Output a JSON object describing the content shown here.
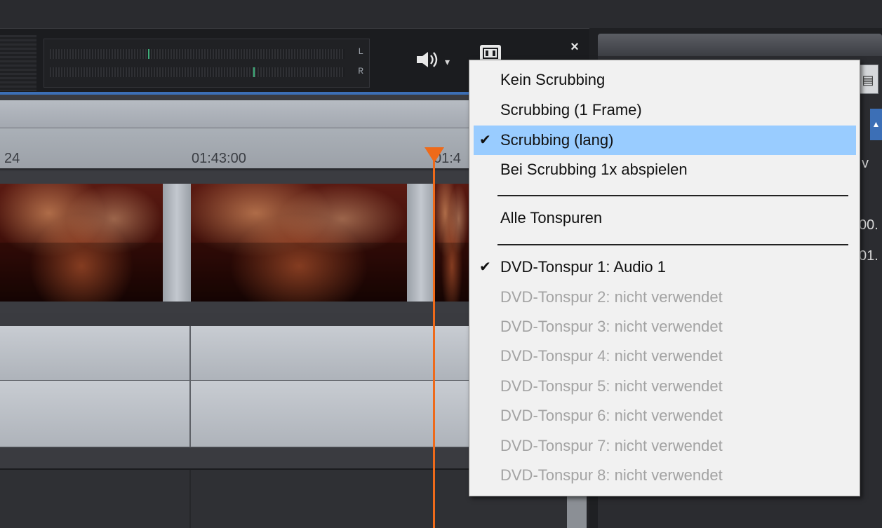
{
  "meter": {
    "left_label": "L",
    "right_label": "R"
  },
  "toolbar": {
    "speaker_icon": "speaker-icon",
    "dropdown_arrow": "▾",
    "film_icon": "film-icon",
    "close_label": "×"
  },
  "timeline": {
    "ruler_labels": [
      "24",
      "01:43:00",
      "01:4"
    ],
    "playhead_color": "#ee6a1a",
    "accent": "#3c6fb6"
  },
  "right_panel": {
    "peek_texts": [
      "v",
      "00.",
      "01."
    ],
    "scroll_up": "▲"
  },
  "menu": {
    "items": [
      {
        "label": "Kein Scrubbing",
        "checked": false,
        "enabled": true
      },
      {
        "label": "Scrubbing (1 Frame)",
        "checked": false,
        "enabled": true
      },
      {
        "label": "Scrubbing (lang)",
        "checked": true,
        "enabled": true,
        "highlighted": true
      },
      {
        "label": "Bei Scrubbing 1x abspielen",
        "checked": false,
        "enabled": true
      },
      {
        "label": "Alle Tonspuren",
        "checked": false,
        "enabled": true
      },
      {
        "label": "DVD-Tonspur 1: Audio 1",
        "checked": true,
        "enabled": true
      },
      {
        "label": "DVD-Tonspur 2: nicht verwendet",
        "checked": false,
        "enabled": false
      },
      {
        "label": "DVD-Tonspur 3: nicht verwendet",
        "checked": false,
        "enabled": false
      },
      {
        "label": "DVD-Tonspur 4: nicht verwendet",
        "checked": false,
        "enabled": false
      },
      {
        "label": "DVD-Tonspur 5: nicht verwendet",
        "checked": false,
        "enabled": false
      },
      {
        "label": "DVD-Tonspur 6: nicht verwendet",
        "checked": false,
        "enabled": false
      },
      {
        "label": "DVD-Tonspur 7: nicht verwendet",
        "checked": false,
        "enabled": false
      },
      {
        "label": "DVD-Tonspur 8: nicht verwendet",
        "checked": false,
        "enabled": false
      }
    ],
    "check_glyph": "✔"
  }
}
